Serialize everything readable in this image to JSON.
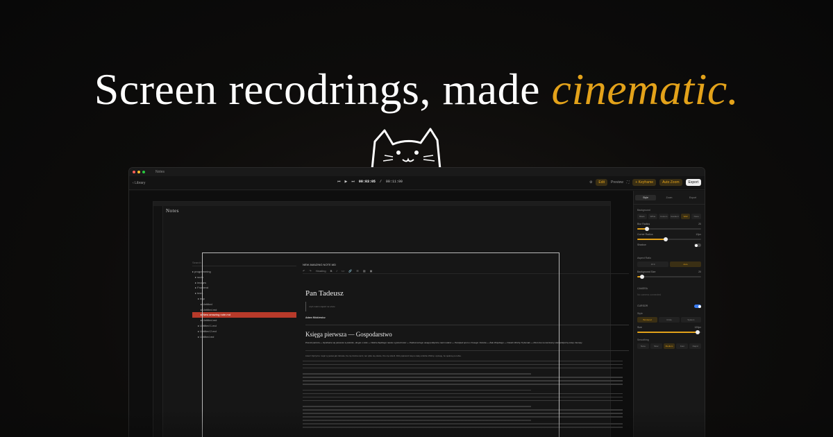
{
  "hero": {
    "text_main": "Screen recodrings, made ",
    "text_accent": "cinematic."
  },
  "colors": {
    "accent": "#e3a21a",
    "selection": "#b83a2a",
    "toggle": "#3b7cf0"
  },
  "window": {
    "title": "Notes",
    "back_label": "Library",
    "time_current": "00:03:05",
    "time_separator": "/",
    "time_total": "00:11:00",
    "edit_tab": "Edit",
    "preview_tab": "Preview",
    "keyframe_label": "+ Keyframe",
    "autozoom_label": "Auto Zoom",
    "export_label": "Export"
  },
  "app": {
    "title": "Notes",
    "tree_search": "Search",
    "tree_rows": [
      "programming",
      "sudo",
      "images",
      "Frontend",
      "test1",
      "tmp",
      "Untitled",
      "Untitled.md",
      "New amazing note.md",
      "Untitled.md",
      "Untitled 1.md",
      "Untitled 2.md",
      "Untitled.md"
    ],
    "selected_index": 8,
    "note_title": "NEW AMAZING NOTE.MD",
    "heading_dropdown": "Heading",
    "doc_title": "Pan Tadeusz",
    "quote": "czyli ostatni zajazd na Litwie",
    "author": "Adam Mickiewicz",
    "book_title": "Księga pierwsza — Gospodarstwo",
    "summary": "Powrót panicza — Spotkanie się pierwsze w pokoiku, drugie u stołu — Ważna Sędziego nauka o grzeczności — Podkomorzego uwagi polityczne nad modami — Początek sporu o Kusego i Sokoła — Żale Wojskiego — Ostatni Woźny Trybunału — Rzut oka na ówczesny stan polityczny Litwy i Europy",
    "first_line": "Litwo! Ojczyzno moja! ty jesteś jak zdrowie; Ile cię trzeba cenić, ten tylko się dowie, Kto cię stracił. Dziś piękność twą w całej ozdobie Widzę i opisuję, bo tęsknię po tobie."
  },
  "inspector": {
    "tabs": [
      "Style",
      "Zoom",
      "Export"
    ],
    "background_label": "Background",
    "bg_options": [
      "Black",
      "White",
      "Custom",
      "Gradient",
      "Wall",
      "None"
    ],
    "bg_active": 4,
    "blur_label": "Blur Radius",
    "blur_value": 20,
    "blur_fraction": 0.15,
    "corner_label": "Corner Radius",
    "corner_value": "12px",
    "corner_fraction": 0.45,
    "shadow_label": "Shadow",
    "shadow_on": false,
    "aspect_label": "Aspect Ratio",
    "aspect_options": [
      "16:9",
      "Auto"
    ],
    "aspect_active": 1,
    "padding_label": "Background Size",
    "padding_value": 20,
    "padding_fraction": 0.08,
    "camera_label": "CAMERA",
    "camera_value": "No camera connected",
    "cursor_label": "CURSOR",
    "cursor_on": true,
    "style_label": "Style",
    "cursor_styles": [
      "Bordered",
      "Circle",
      "System"
    ],
    "cursor_active": 0,
    "size_label": "Size",
    "size_value": "120px",
    "size_fraction": 0.95,
    "smoothing_label": "Smoothing",
    "smoothing_options": [
      "None",
      "Slow",
      "Medium",
      "Fast",
      "Rapid"
    ],
    "smoothing_active": 2
  }
}
